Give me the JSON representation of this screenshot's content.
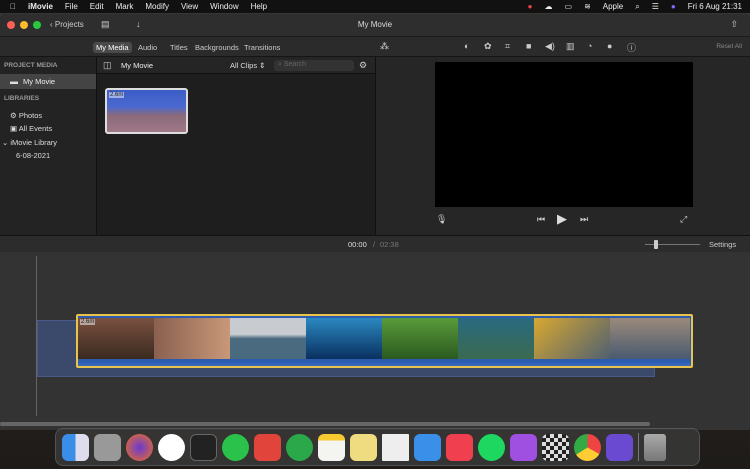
{
  "menubar": {
    "app": "iMovie",
    "items": [
      "File",
      "Edit",
      "Mark",
      "Modify",
      "View",
      "Window",
      "Help"
    ],
    "user": "Apple",
    "datetime": "Fri 6 Aug  21:31"
  },
  "window": {
    "title": "My Movie",
    "projects_button": "Projects"
  },
  "tabs": [
    "My Media",
    "Audio",
    "Titles",
    "Backgrounds",
    "Transitions"
  ],
  "viewer_tools": {
    "reset_all": "Reset All"
  },
  "sidebar": {
    "project_media_header": "PROJECT MEDIA",
    "project_item": "My Movie",
    "libraries_header": "LIBRARIES",
    "items": [
      "Photos",
      "All Events"
    ],
    "library": "iMovie Library",
    "event": "6-08-2021"
  },
  "browser": {
    "title": "My Movie",
    "filter": "All Clips",
    "search_placeholder": "Search",
    "clip_duration": "2.6m"
  },
  "timeline": {
    "current_time": "00:00",
    "separator": "/",
    "total_time": "02:38",
    "settings": "Settings",
    "clip_duration": "2.6m"
  },
  "dock": {
    "apps": [
      "Finder",
      "Launchpad",
      "Firefox",
      "Xcode",
      "Terminal",
      "WhatsApp",
      "Todoist",
      "Evernote",
      "Notes",
      "Stickies",
      "TextEdit",
      "Mail",
      "Music",
      "Spotify",
      "Podcasts",
      "Chess",
      "Chrome",
      "iMovie",
      "Trash"
    ]
  }
}
